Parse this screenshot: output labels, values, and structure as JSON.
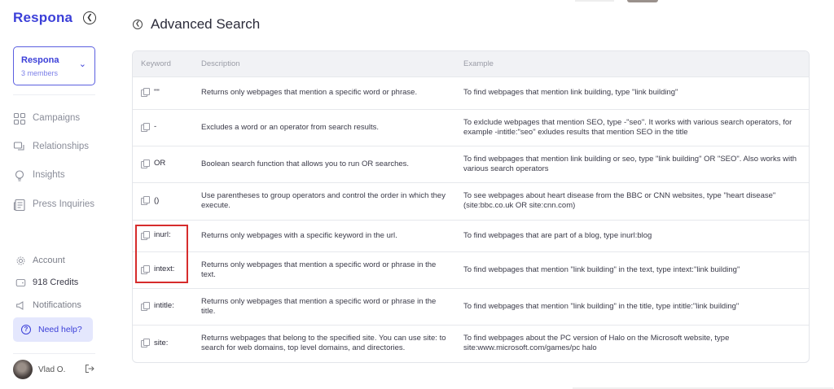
{
  "sidebar": {
    "logo": "Respona",
    "team": {
      "name": "Respona",
      "members": "3 members"
    },
    "nav": [
      {
        "label": "Campaigns",
        "icon": "grid-icon"
      },
      {
        "label": "Relationships",
        "icon": "chat-icon"
      },
      {
        "label": "Insights",
        "icon": "lightbulb-icon"
      },
      {
        "label": "Press Inquiries",
        "icon": "newspaper-icon"
      }
    ],
    "bottom": [
      {
        "label": "Account",
        "icon": "gear-icon"
      },
      {
        "label": "918 Credits",
        "icon": "wallet-icon"
      },
      {
        "label": "Notifications",
        "icon": "megaphone-icon"
      }
    ],
    "help": "Need help?",
    "user": "Vlad O."
  },
  "header": {
    "title": "Advanced Search"
  },
  "table": {
    "columns": [
      "Keyword",
      "Description",
      "Example"
    ],
    "rows": [
      {
        "keyword": "\"\"",
        "description": "Returns only webpages that mention a specific word or phrase.",
        "example": "To find webpages that mention link building, type \"link building\""
      },
      {
        "keyword": "-",
        "description": "Excludes a word or an operator from search results.",
        "example": "To exlclude webpages that mention SEO, type -\"seo\". It works with various search operators, for example -intitle:\"seo\" exludes results that mention SEO in the title"
      },
      {
        "keyword": "OR",
        "description": "Boolean search function that allows you to run OR searches.",
        "example": "To find webpages that mention link building or seo, type \"link building\" OR \"SEO\". Also works with various search operators"
      },
      {
        "keyword": "()",
        "description": "Use parentheses to group operators and control the order in which they execute.",
        "example": "To see webpages about heart disease from the BBC or CNN websites, type \"heart disease\" (site:bbc.co.uk OR site:cnn.com)"
      },
      {
        "keyword": "inurl:",
        "description": "Returns only webpages with a specific keyword in the url.",
        "example": "To find webpages that are part of a blog, type inurl:blog"
      },
      {
        "keyword": "intext:",
        "description": "Returns only webpages that mention a specific word or phrase in the text.",
        "example": "To find webpages that mention \"link building\" in the text, type intext:\"link building\""
      },
      {
        "keyword": "intitle:",
        "description": "Returns only webpages that mention a specific word or phrase in the title.",
        "example": "To find webpages that mention \"link building\" in the title, type intitle:\"link building\""
      },
      {
        "keyword": "site:",
        "description": "Returns webpages that belong to the specified site. You can use site: to search for web domains, top level domains, and directories.",
        "example": "To find webpages about the PC version of Halo on the Microsoft website, type site:www.microsoft.com/games/pc halo"
      }
    ]
  },
  "colors": {
    "brand": "#3b3fd8",
    "highlight": "#d62c2c"
  }
}
